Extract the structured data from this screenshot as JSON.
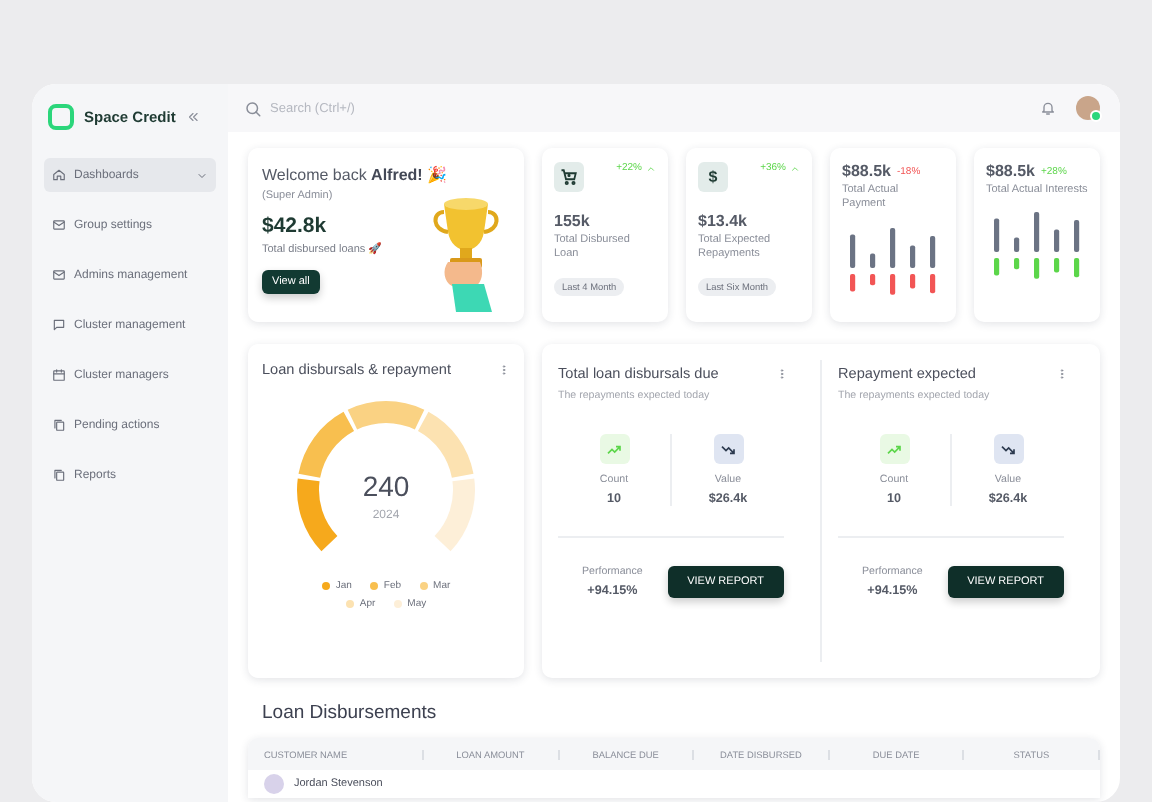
{
  "brand": {
    "name": "Space Credit"
  },
  "sidebar": {
    "items": [
      {
        "label": "Dashboards",
        "kind": "group",
        "selected": true
      },
      {
        "label": "Group settings",
        "kind": "link",
        "selected": false
      },
      {
        "label": "Admins management",
        "kind": "link",
        "selected": false
      },
      {
        "label": "Cluster management",
        "kind": "link",
        "selected": false
      },
      {
        "label": "Cluster managers",
        "kind": "link",
        "selected": false
      },
      {
        "label": "Pending actions",
        "kind": "link",
        "selected": false
      },
      {
        "label": "Reports",
        "kind": "link",
        "selected": false
      }
    ]
  },
  "topbar": {
    "search": {
      "placeholder": "Search (Ctrl+/)"
    }
  },
  "welcome": {
    "title": "Welcome back **Alfred!** 🎉",
    "role": "(Super Admin)",
    "amount": "$42.8k",
    "caption": "Total disbursed loans 🚀",
    "button": "View all"
  },
  "stat_cards": [
    {
      "kind": "metric",
      "trend": {
        "text": "+22%",
        "positive": true
      },
      "value": "155k",
      "label": "Total Disbursed Loan",
      "chip": "Last 4 Month"
    },
    {
      "kind": "metric",
      "icon_text": "$",
      "trend": {
        "text": "+36%",
        "positive": true
      },
      "value": "$13.4k",
      "label": "Total Expected Repayments",
      "chip": "Last Six Month"
    },
    {
      "kind": "bars",
      "value": "$88.5k",
      "trend": {
        "text": "-18%",
        "positive": false
      },
      "label": "Total Actual Payment"
    },
    {
      "kind": "bars",
      "value": "$88.5k",
      "trend": {
        "text": "+28%",
        "positive": true
      },
      "label": "Total Actual Interests"
    }
  ],
  "gauge_card": {
    "title": "Loan disbursals & repayment",
    "value": "240",
    "year": "2024",
    "legend": [
      {
        "label": "Jan",
        "color": "#f6a91c"
      },
      {
        "label": "Feb",
        "color": "#f8bf4f"
      },
      {
        "label": "Mar",
        "color": "#fad283"
      },
      {
        "label": "Apr",
        "color": "#fce2b1"
      },
      {
        "label": "May",
        "color": "#fdefd8"
      }
    ]
  },
  "due_panels": [
    {
      "title": "Total loan disbursals due",
      "subtitle": "The repayments expected today",
      "stats": [
        {
          "label": "Count",
          "value": "10",
          "rising": true
        },
        {
          "label": "Value",
          "value": "$26.4k",
          "rising": false
        }
      ],
      "performance_label": "Performance",
      "performance": "+94.15%",
      "button": "VIEW REPORT"
    },
    {
      "title": "Repayment expected",
      "subtitle": "The repayments expected today",
      "stats": [
        {
          "label": "Count",
          "value": "10",
          "rising": true
        },
        {
          "label": "Value",
          "value": "$26.4k",
          "rising": false
        }
      ],
      "performance_label": "Performance",
      "performance": "+94.15%",
      "button": "VIEW REPORT"
    }
  ],
  "table": {
    "title": "Loan Disbursements",
    "columns": [
      "CUSTOMER NAME",
      "LOAN AMOUNT",
      "BALANCE DUE",
      "DATE DISBURSED",
      "DUE DATE",
      "STATUS"
    ],
    "rows": [
      {
        "customer": "Jordan Stevenson"
      }
    ]
  }
}
